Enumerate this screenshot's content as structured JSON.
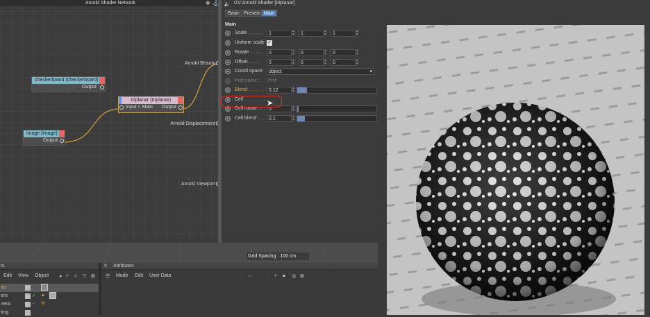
{
  "node_editor": {
    "title": "Arnold Shader Network",
    "nodes": {
      "checkerboard": {
        "title": "checkerboard (checkerboard)",
        "output": "Output"
      },
      "triplanar": {
        "title": "triplanar (triplanar)",
        "input": "Input < Main",
        "output": "Output"
      },
      "image": {
        "title": "image (image)",
        "output": "Output"
      }
    },
    "outputs": {
      "beauty": "Arnold Beauty",
      "displacement": "Arnold Displacement",
      "viewport": "Arnold Viewport"
    }
  },
  "attributes_panel": {
    "title": "GV Arnold Shader [triplanar]",
    "tabs": [
      "Basic",
      "Presets",
      "Main"
    ],
    "active_tab": "Main",
    "section": "Main",
    "params": {
      "scale": {
        "label": "Scale . . . . . .",
        "values": [
          "1",
          "1",
          "1"
        ]
      },
      "uniform_scale": {
        "label": "Uniform scale",
        "checked": true,
        "check_glyph": "✓"
      },
      "rotate": {
        "label": "Rotate . . . . .",
        "values": [
          "0",
          "0",
          "0"
        ]
      },
      "offset": {
        "label": "Offset . . . . .",
        "values": [
          "0",
          "0",
          "0"
        ]
      },
      "coord_space": {
        "label": "Coord space",
        "value": "object"
      },
      "pref_name": {
        "label": "Pref name . . .",
        "value": "Pref"
      },
      "blend": {
        "label": "Blend . . . . . .",
        "value": "0.12",
        "level": 0.12
      },
      "cell": {
        "label": "Cell . . . . . . . . ."
      },
      "cell_rotate": {
        "label": "Cell rotate . . .",
        "value": "0",
        "level": 0
      },
      "cell_blend": {
        "label": "Cell blend . . .",
        "value": "0.1",
        "level": 0.1
      }
    }
  },
  "viewport": {
    "grid_spacing": "Grid Spacing : 100 cm"
  },
  "object_manager": {
    "header": "ts",
    "menu": [
      "Edit",
      "View",
      "Object"
    ],
    "rows": [
      "so",
      "ere",
      "nera",
      "ting"
    ]
  },
  "attributes_manager": {
    "header": "Attributes",
    "menu": [
      "Mode",
      "Edit",
      "User Data"
    ]
  },
  "colors": {
    "accent": "#4d7fc2",
    "highlight": "#e0302a",
    "wire": "#d6a040",
    "blend_label": "#e0a64a"
  }
}
